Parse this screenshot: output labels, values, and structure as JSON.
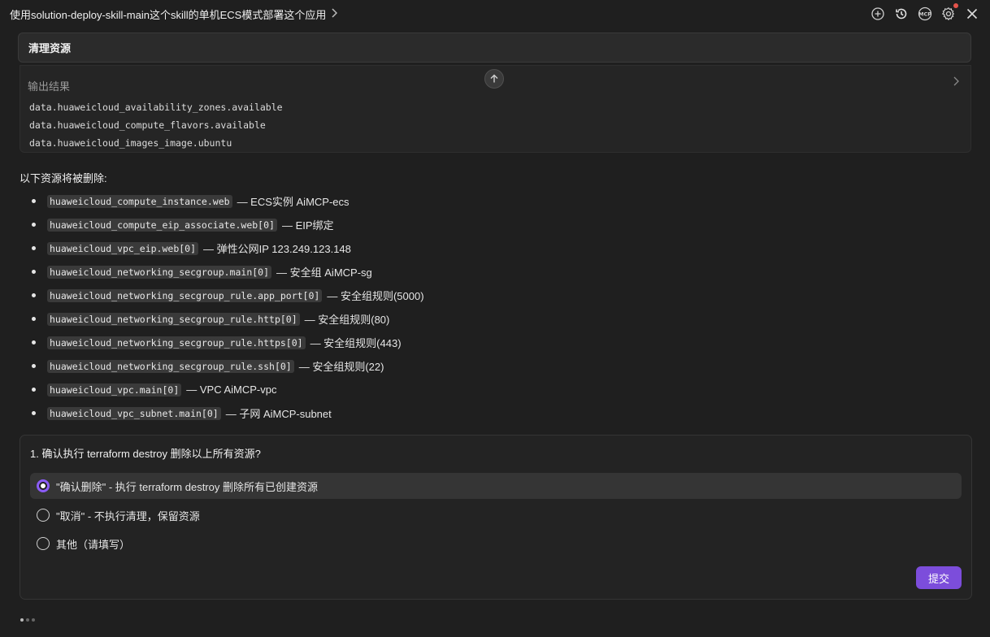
{
  "header": {
    "title": "使用solution-deploy-skill-main这个skill的单机ECS模式部署这个应用",
    "icons": [
      "new-chat-icon",
      "history-icon",
      "mcp-icon",
      "settings-icon",
      "close-icon"
    ],
    "mcp_label": "MCP"
  },
  "task": {
    "label": "清理资源"
  },
  "output": {
    "header": "输出结果",
    "lines": [
      "data.huaweicloud_availability_zones.available",
      "data.huaweicloud_compute_flavors.available",
      "data.huaweicloud_images_image.ubuntu"
    ]
  },
  "resources": {
    "heading": "以下资源将被删除:",
    "items": [
      {
        "code": "huaweicloud_compute_instance.web",
        "desc": "— ECS实例 AiMCP-ecs"
      },
      {
        "code": "huaweicloud_compute_eip_associate.web[0]",
        "desc": "— EIP绑定"
      },
      {
        "code": "huaweicloud_vpc_eip.web[0]",
        "desc": "— 弹性公网IP 123.249.123.148"
      },
      {
        "code": "huaweicloud_networking_secgroup.main[0]",
        "desc": "— 安全组 AiMCP-sg"
      },
      {
        "code": "huaweicloud_networking_secgroup_rule.app_port[0]",
        "desc": "— 安全组规则(5000)"
      },
      {
        "code": "huaweicloud_networking_secgroup_rule.http[0]",
        "desc": "— 安全组规则(80)"
      },
      {
        "code": "huaweicloud_networking_secgroup_rule.https[0]",
        "desc": "— 安全组规则(443)"
      },
      {
        "code": "huaweicloud_networking_secgroup_rule.ssh[0]",
        "desc": "— 安全组规则(22)"
      },
      {
        "code": "huaweicloud_vpc.main[0]",
        "desc": "— VPC AiMCP-vpc"
      },
      {
        "code": "huaweicloud_vpc_subnet.main[0]",
        "desc": "— 子网 AiMCP-subnet"
      }
    ]
  },
  "question": {
    "title": "1. 确认执行 terraform destroy 删除以上所有资源?",
    "options": [
      {
        "label": "\"确认删除\" - 执行 terraform destroy 删除所有已创建资源",
        "selected": true
      },
      {
        "label": "\"取消\" - 不执行清理，保留资源",
        "selected": false
      },
      {
        "label": "其他（请填写）",
        "selected": false
      }
    ],
    "submit_label": "提交",
    "accent_color": "#8b5cf6"
  }
}
